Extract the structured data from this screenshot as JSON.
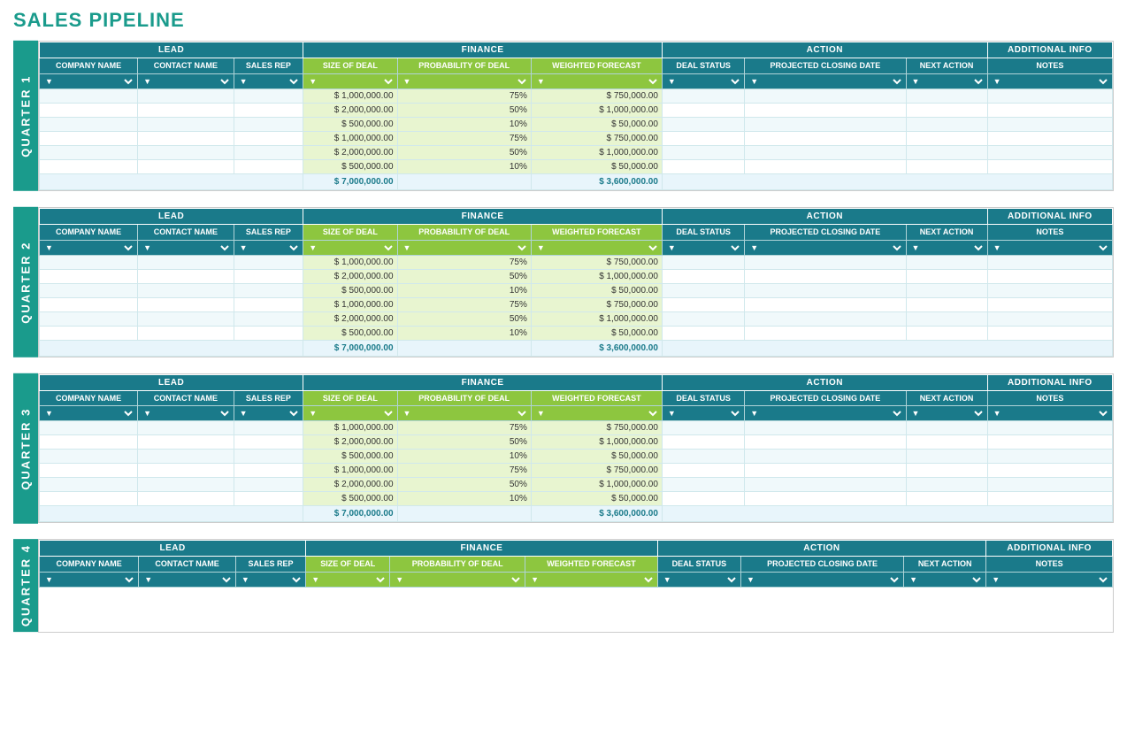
{
  "title": "SALES PIPELINE",
  "sections": {
    "lead": "LEAD",
    "finance": "FINANCE",
    "action": "ACTION",
    "additional_info": "ADDITIONAL INFO"
  },
  "columns": {
    "company_name": "COMPANY NAME",
    "contact_name": "CONTACT NAME",
    "sales_rep": "SALES REP",
    "size_of_deal": "SIZE OF DEAL",
    "probability_of_deal": "PROBABILITY OF DEAL",
    "weighted_forecast": "WEIGHTED FORECAST",
    "deal_status": "DEAL STATUS",
    "projected_closing_date": "PROJECTED CLOSING DATE",
    "next_action": "NEXT ACTION",
    "notes": "NOTES"
  },
  "quarters": [
    {
      "label": "QUARTER 1",
      "rows": [
        {
          "deal_size": "$ 1,000,000.00",
          "prob": "75%",
          "weighted": "$ 750,000.00"
        },
        {
          "deal_size": "$ 2,000,000.00",
          "prob": "50%",
          "weighted": "$ 1,000,000.00"
        },
        {
          "deal_size": "$ 500,000.00",
          "prob": "10%",
          "weighted": "$ 50,000.00"
        },
        {
          "deal_size": "$ 1,000,000.00",
          "prob": "75%",
          "weighted": "$ 750,000.00"
        },
        {
          "deal_size": "$ 2,000,000.00",
          "prob": "50%",
          "weighted": "$ 1,000,000.00"
        },
        {
          "deal_size": "$ 500,000.00",
          "prob": "10%",
          "weighted": "$ 50,000.00"
        }
      ],
      "total_deal": "$ 7,000,000.00",
      "total_weighted": "$ 3,600,000.00"
    },
    {
      "label": "QUARTER 2",
      "rows": [
        {
          "deal_size": "$ 1,000,000.00",
          "prob": "75%",
          "weighted": "$ 750,000.00"
        },
        {
          "deal_size": "$ 2,000,000.00",
          "prob": "50%",
          "weighted": "$ 1,000,000.00"
        },
        {
          "deal_size": "$ 500,000.00",
          "prob": "10%",
          "weighted": "$ 50,000.00"
        },
        {
          "deal_size": "$ 1,000,000.00",
          "prob": "75%",
          "weighted": "$ 750,000.00"
        },
        {
          "deal_size": "$ 2,000,000.00",
          "prob": "50%",
          "weighted": "$ 1,000,000.00"
        },
        {
          "deal_size": "$ 500,000.00",
          "prob": "10%",
          "weighted": "$ 50,000.00"
        }
      ],
      "total_deal": "$ 7,000,000.00",
      "total_weighted": "$ 3,600,000.00"
    },
    {
      "label": "QUARTER 3",
      "rows": [
        {
          "deal_size": "$ 1,000,000.00",
          "prob": "75%",
          "weighted": "$ 750,000.00"
        },
        {
          "deal_size": "$ 2,000,000.00",
          "prob": "50%",
          "weighted": "$ 1,000,000.00"
        },
        {
          "deal_size": "$ 500,000.00",
          "prob": "10%",
          "weighted": "$ 50,000.00"
        },
        {
          "deal_size": "$ 1,000,000.00",
          "prob": "75%",
          "weighted": "$ 750,000.00"
        },
        {
          "deal_size": "$ 2,000,000.00",
          "prob": "50%",
          "weighted": "$ 1,000,000.00"
        },
        {
          "deal_size": "$ 500,000.00",
          "prob": "10%",
          "weighted": "$ 50,000.00"
        }
      ],
      "total_deal": "$ 7,000,000.00",
      "total_weighted": "$ 3,600,000.00"
    },
    {
      "label": "QUARTER 4",
      "rows": [],
      "total_deal": "",
      "total_weighted": ""
    }
  ],
  "colors": {
    "teal": "#1a7a8a",
    "green": "#8dc63f",
    "light_teal_bg": "#e8f5fb",
    "title_color": "#1a9b8c"
  }
}
